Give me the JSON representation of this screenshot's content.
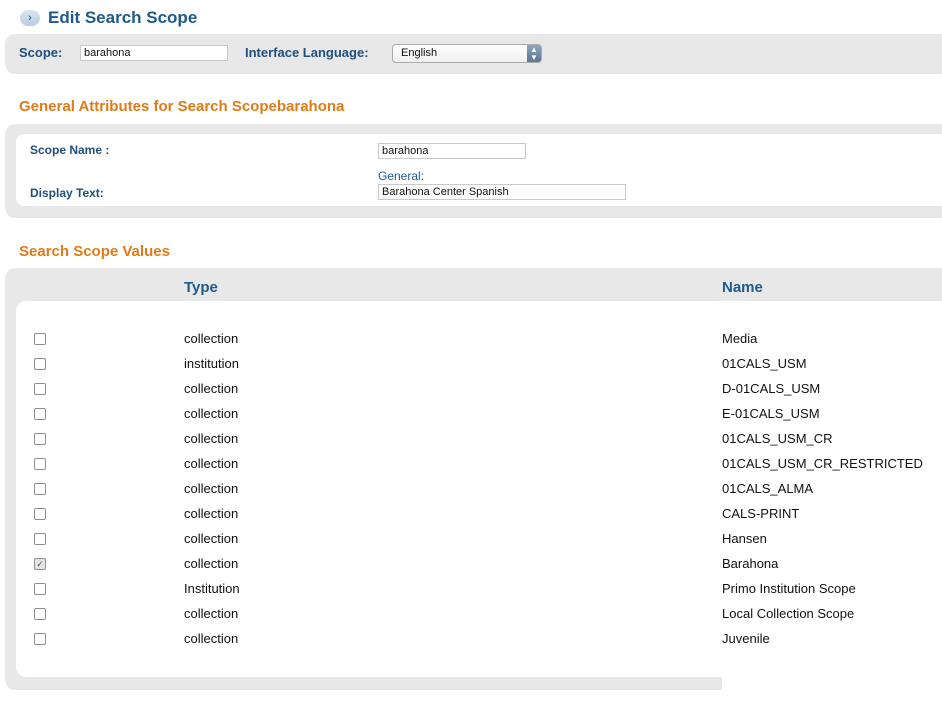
{
  "header": {
    "title": "Edit Search Scope",
    "back_icon": "chevron-right-icon"
  },
  "scope_bar": {
    "scope_label": "Scope:",
    "scope_value": "barahona",
    "language_label": "Interface Language:",
    "language_selected": "English"
  },
  "general": {
    "section_title": "General Attributes for Search Scopebarahona",
    "scope_name_label": "Scope Name :",
    "scope_name_value": "barahona",
    "display_text_label": "Display Text:",
    "general_sublabel": "General:",
    "display_text_value": "Barahona Center Spanish"
  },
  "values": {
    "section_title": "Search Scope Values",
    "columns": {
      "type": "Type",
      "name": "Name"
    },
    "rows": [
      {
        "type": "collection",
        "name": "Media",
        "checked": false
      },
      {
        "type": "institution",
        "name": "01CALS_USM",
        "checked": false
      },
      {
        "type": "collection",
        "name": "D-01CALS_USM",
        "checked": false
      },
      {
        "type": "collection",
        "name": "E-01CALS_USM",
        "checked": false
      },
      {
        "type": "collection",
        "name": "01CALS_USM_CR",
        "checked": false
      },
      {
        "type": "collection",
        "name": "01CALS_USM_CR_RESTRICTED",
        "checked": false
      },
      {
        "type": "collection",
        "name": "01CALS_ALMA",
        "checked": false
      },
      {
        "type": "collection",
        "name": "CALS-PRINT",
        "checked": false
      },
      {
        "type": "collection",
        "name": "Hansen",
        "checked": false
      },
      {
        "type": "collection",
        "name": "Barahona",
        "checked": true
      },
      {
        "type": "Institution",
        "name": "Primo Institution Scope",
        "checked": false
      },
      {
        "type": "collection",
        "name": "Local Collection Scope",
        "checked": false
      },
      {
        "type": "collection",
        "name": "Juvenile",
        "checked": false
      }
    ]
  },
  "colors": {
    "heading_blue": "#1f5a8c",
    "section_orange": "#e07b17",
    "panel_gray": "#e8e8e8"
  }
}
